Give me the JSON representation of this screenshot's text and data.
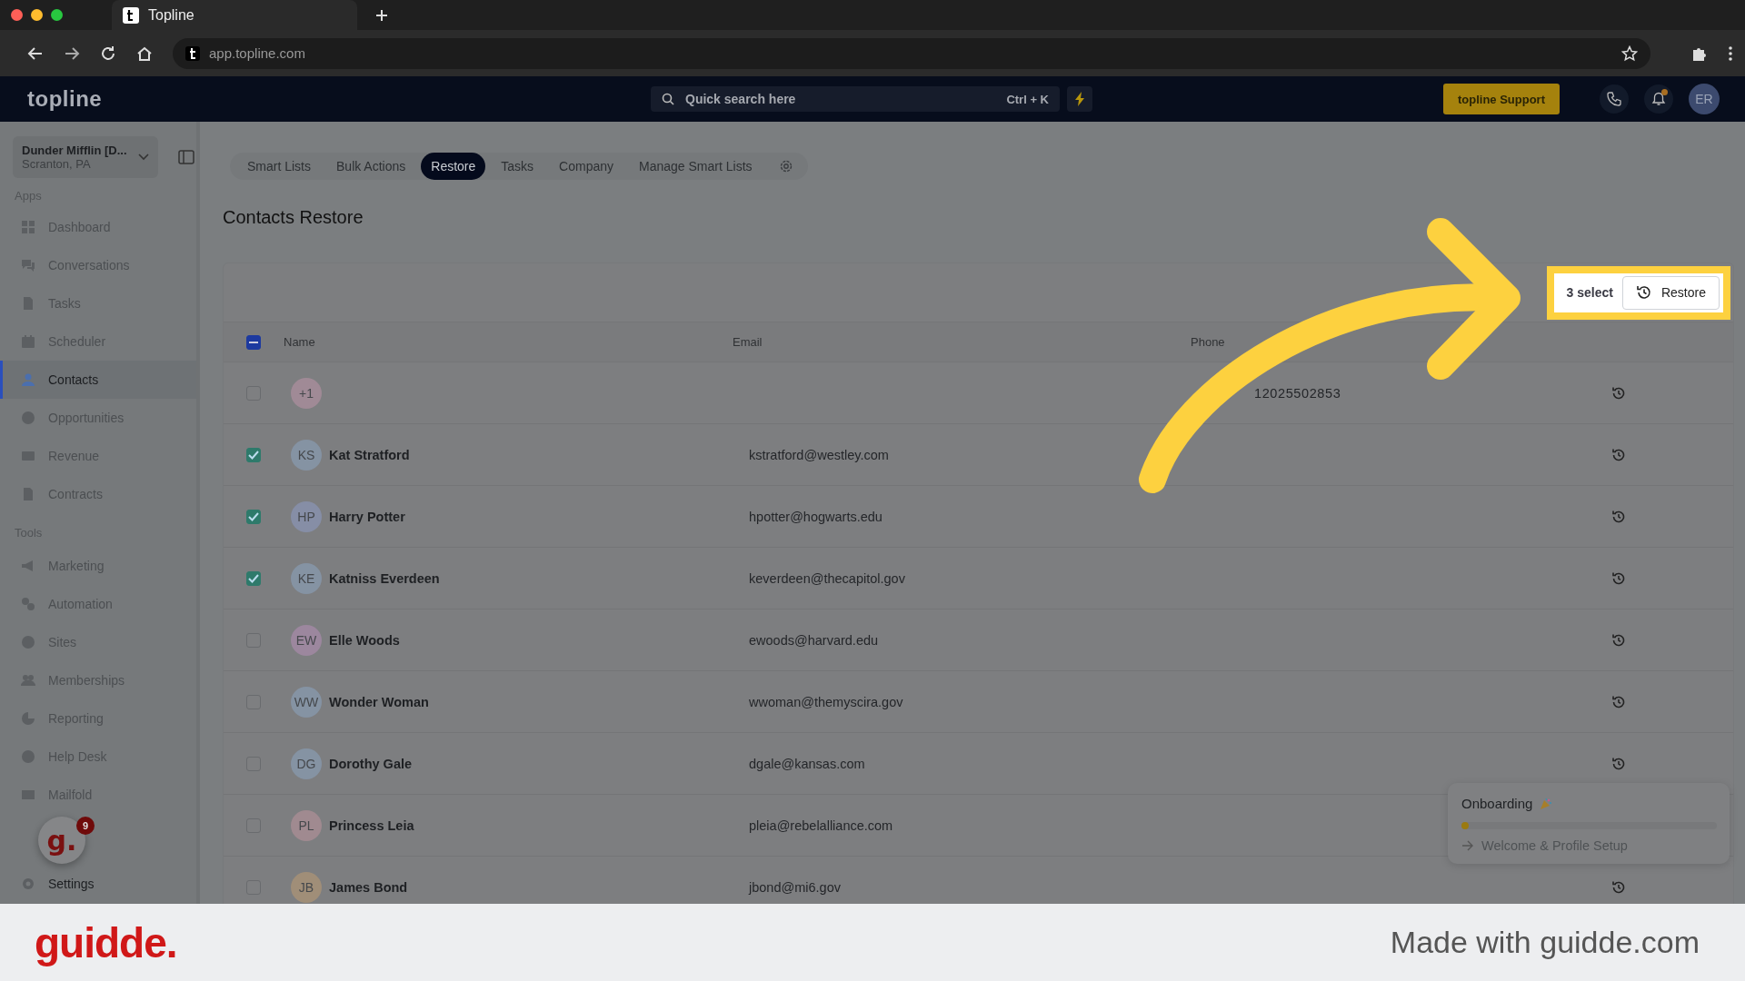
{
  "browser": {
    "tab_title": "Topline",
    "url": "app.topline.com"
  },
  "header": {
    "logo": "topline",
    "search": {
      "placeholder": "Quick search here",
      "shortcut": "Ctrl + K"
    },
    "support_button": "topline Support",
    "avatar": "ER",
    "notification_dot": true
  },
  "sidebar": {
    "account": {
      "name": "Dunder Mifflin [D...",
      "location": "Scranton, PA"
    },
    "sections": [
      {
        "title": "Apps",
        "items": [
          {
            "label": "Dashboard",
            "selected": false
          },
          {
            "label": "Conversations",
            "selected": false
          },
          {
            "label": "Tasks",
            "selected": false
          },
          {
            "label": "Scheduler",
            "selected": false
          },
          {
            "label": "Contacts",
            "selected": true
          },
          {
            "label": "Opportunities",
            "selected": false
          },
          {
            "label": "Revenue",
            "selected": false
          },
          {
            "label": "Contracts",
            "selected": false
          }
        ]
      },
      {
        "title": "Tools",
        "items": [
          {
            "label": "Marketing",
            "selected": false
          },
          {
            "label": "Automation",
            "selected": false
          },
          {
            "label": "Sites",
            "selected": false
          },
          {
            "label": "Memberships",
            "selected": false
          },
          {
            "label": "Reporting",
            "selected": false
          },
          {
            "label": "Help Desk",
            "selected": false
          },
          {
            "label": "Mailfold",
            "selected": false
          }
        ]
      }
    ],
    "settings": "Settings"
  },
  "guidde_widget": {
    "letter": "g.",
    "count": "9"
  },
  "tabs": [
    {
      "label": "Smart Lists",
      "selected": false
    },
    {
      "label": "Bulk Actions",
      "selected": false
    },
    {
      "label": "Restore",
      "selected": true
    },
    {
      "label": "Tasks",
      "selected": false
    },
    {
      "label": "Company",
      "selected": false
    },
    {
      "label": "Manage Smart Lists",
      "selected": false
    }
  ],
  "page_title": "Contacts Restore",
  "bulk_bar": {
    "selected_count": "3 select",
    "button": "Restore"
  },
  "table": {
    "columns": [
      "Name",
      "Email",
      "Phone"
    ],
    "header_checkbox": {
      "indeterminate": true
    },
    "rows": [
      {
        "initials": "+1",
        "color": "#a08a96",
        "name": "",
        "email": "",
        "phone": "12025502853",
        "checked": false
      },
      {
        "initials": "KS",
        "color": "#8593a3",
        "name": "Kat Stratford",
        "email": "kstratford@westley.com",
        "phone": "",
        "checked": true
      },
      {
        "initials": "HP",
        "color": "#868ea6",
        "name": "Harry Potter",
        "email": "hpotter@hogwarts.edu",
        "phone": "",
        "checked": true
      },
      {
        "initials": "KE",
        "color": "#8593a3",
        "name": "Katniss Everdeen",
        "email": "keverdeen@thecapitol.gov",
        "phone": "",
        "checked": true
      },
      {
        "initials": "EW",
        "color": "#9c879e",
        "name": "Elle Woods",
        "email": "ewoods@harvard.edu",
        "phone": "",
        "checked": false
      },
      {
        "initials": "WW",
        "color": "#8593a3",
        "name": "Wonder Woman",
        "email": "wwoman@themyscira.gov",
        "phone": "",
        "checked": false
      },
      {
        "initials": "DG",
        "color": "#8593a3",
        "name": "Dorothy Gale",
        "email": "dgale@kansas.com",
        "phone": "",
        "checked": false
      },
      {
        "initials": "PL",
        "color": "#a08a90",
        "name": "Princess Leia",
        "email": "pleia@rebelalliance.com",
        "phone": "",
        "checked": false
      },
      {
        "initials": "JB",
        "color": "#a08e78",
        "name": "James Bond",
        "email": "jbond@mi6.gov",
        "phone": "",
        "checked": false
      }
    ]
  },
  "onboarding": {
    "title": "Onboarding",
    "level": 0.03,
    "step": "Welcome & Profile Setup"
  },
  "footer": {
    "logo": "guidde.",
    "tagline": "Made with guidde.com"
  }
}
